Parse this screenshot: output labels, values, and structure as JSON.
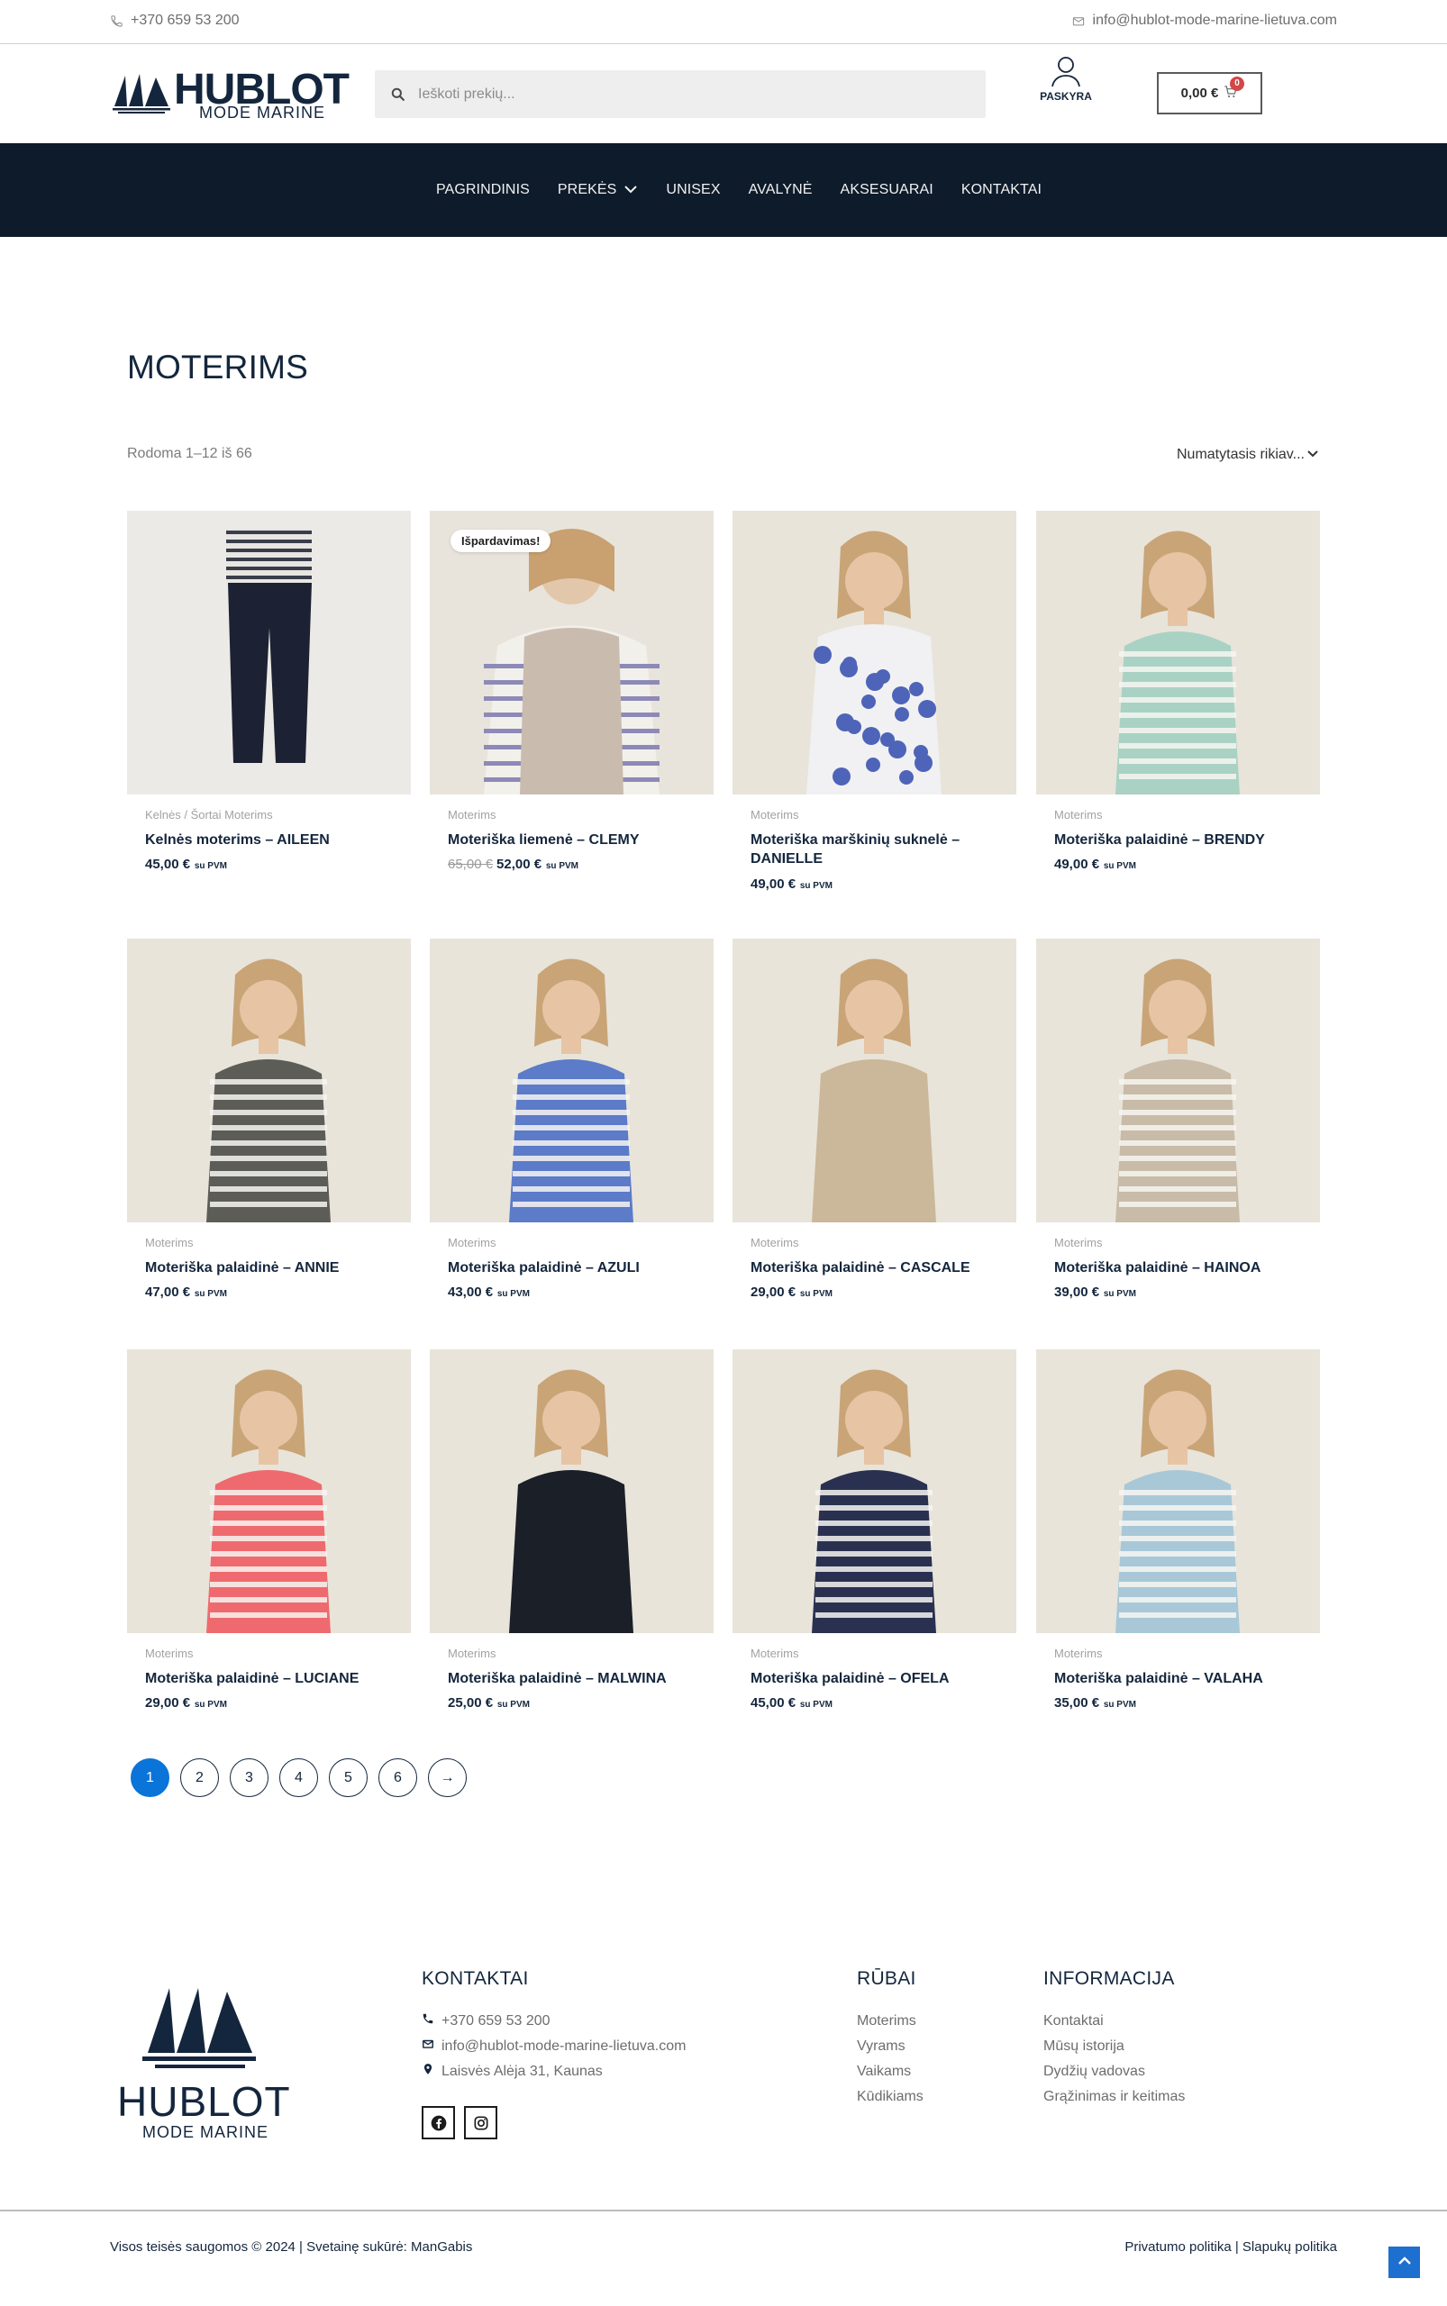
{
  "topbar": {
    "phone": "+370 659 53 200",
    "email": "info@hublot-mode-marine-lietuva.com"
  },
  "header": {
    "logo_word": "HUBLOT",
    "logo_sub": "MODE MARINE",
    "search_placeholder": "Ieškoti prekių...",
    "account_label": "PASKYRA",
    "cart_total": "0,00 €",
    "cart_count": "0"
  },
  "nav": {
    "items": [
      {
        "label": "PAGRINDINIS"
      },
      {
        "label": "PREKĖS",
        "has_dropdown": true
      },
      {
        "label": "UNISEX"
      },
      {
        "label": "AVALYNĖ"
      },
      {
        "label": "AKSESUARAI"
      },
      {
        "label": "KONTAKTAI"
      }
    ]
  },
  "main": {
    "title": "MOTERIMS",
    "result_count": "Rodoma 1–12 iš 66",
    "ordering": "Numatytasis rikiav..."
  },
  "tax_label": "su PVM",
  "sale_badge": "Išpardavimas!",
  "products": [
    {
      "category": "Kelnės / Šortai Moterims",
      "name": "Kelnės moterims – AILEEN",
      "price": "45,00 €",
      "old_price": "",
      "sale": false,
      "bg": "#eceae6",
      "color": "#1c2233",
      "type": "pants"
    },
    {
      "category": "Moterims",
      "name": "Moteriška liemenė – CLEMY",
      "price": "52,00 €",
      "old_price": "65,00 €",
      "sale": true,
      "bg": "#e8e4dc",
      "color": "#c9bcae",
      "type": "vest"
    },
    {
      "category": "Moterims",
      "name": "Moteriška marškinių suknelė – DANIELLE",
      "price": "49,00 €",
      "old_price": "",
      "sale": false,
      "bg": "#e8e4da",
      "color": "#4e64b8",
      "type": "dress"
    },
    {
      "category": "Moterims",
      "name": "Moteriška palaidinė – BRENDY",
      "price": "49,00 €",
      "old_price": "",
      "sale": false,
      "bg": "#e8e4da",
      "color": "#a9d2c4",
      "type": "stripe"
    },
    {
      "category": "Moterims",
      "name": "Moteriška palaidinė – ANNIE",
      "price": "47,00 €",
      "old_price": "",
      "sale": false,
      "bg": "#e8e4da",
      "color": "#5d5d57",
      "type": "stripe"
    },
    {
      "category": "Moterims",
      "name": "Moteriška palaidinė – AZULI",
      "price": "43,00 €",
      "old_price": "",
      "sale": false,
      "bg": "#e8e4da",
      "color": "#5c7bc9",
      "type": "stripe"
    },
    {
      "category": "Moterims",
      "name": "Moteriška palaidinė – CASCALE",
      "price": "29,00 €",
      "old_price": "",
      "sale": false,
      "bg": "#e8e4da",
      "color": "#cbb79a",
      "type": "plain"
    },
    {
      "category": "Moterims",
      "name": "Moteriška palaidinė – HAINOA",
      "price": "39,00 €",
      "old_price": "",
      "sale": false,
      "bg": "#e8e4da",
      "color": "#c8bba8",
      "type": "stripe"
    },
    {
      "category": "Moterims",
      "name": "Moteriška palaidinė – LUCIANE",
      "price": "29,00 €",
      "old_price": "",
      "sale": false,
      "bg": "#e8e4da",
      "color": "#ef6a6e",
      "type": "stripe"
    },
    {
      "category": "Moterims",
      "name": "Moteriška palaidinė – MALWINA",
      "price": "25,00 €",
      "old_price": "",
      "sale": false,
      "bg": "#e8e4da",
      "color": "#1b1f28",
      "type": "plain"
    },
    {
      "category": "Moterims",
      "name": "Moteriška palaidinė – OFELA",
      "price": "45,00 €",
      "old_price": "",
      "sale": false,
      "bg": "#e8e4da",
      "color": "#2a3150",
      "type": "stripe"
    },
    {
      "category": "Moterims",
      "name": "Moteriška palaidinė – VALAHA",
      "price": "35,00 €",
      "old_price": "",
      "sale": false,
      "bg": "#e8e4da",
      "color": "#a8c8d8",
      "type": "stripe"
    }
  ],
  "pagination": {
    "pages": [
      "1",
      "2",
      "3",
      "4",
      "5",
      "6"
    ],
    "next": "→",
    "current": "1"
  },
  "footer": {
    "contacts_title": "KONTAKTAI",
    "phone": "+370 659 53 200",
    "email": "info@hublot-mode-marine-lietuva.com",
    "address": "Laisvės Alėja 31, Kaunas",
    "clothes_title": "RŪBAI",
    "clothes_links": [
      "Moterims",
      "Vyrams",
      "Vaikams",
      "Kūdikiams"
    ],
    "info_title": "INFORMACIJA",
    "info_links": [
      "Kontaktai",
      "Mūsų istorija",
      "Dydžių vadovas",
      "Grąžinimas ir keitimas"
    ],
    "logo_word": "HUBLOT",
    "logo_sub": "MODE MARINE",
    "copyright": "Visos teisės saugomos © 2024 | Svetainę sukūrė: ManGabis",
    "policies": "Privatumo politika | Slapukų politika"
  },
  "colors": {
    "navy": "#0e1b2b",
    "accent_blue": "#0a74d9",
    "sale_red": "#d34747"
  }
}
